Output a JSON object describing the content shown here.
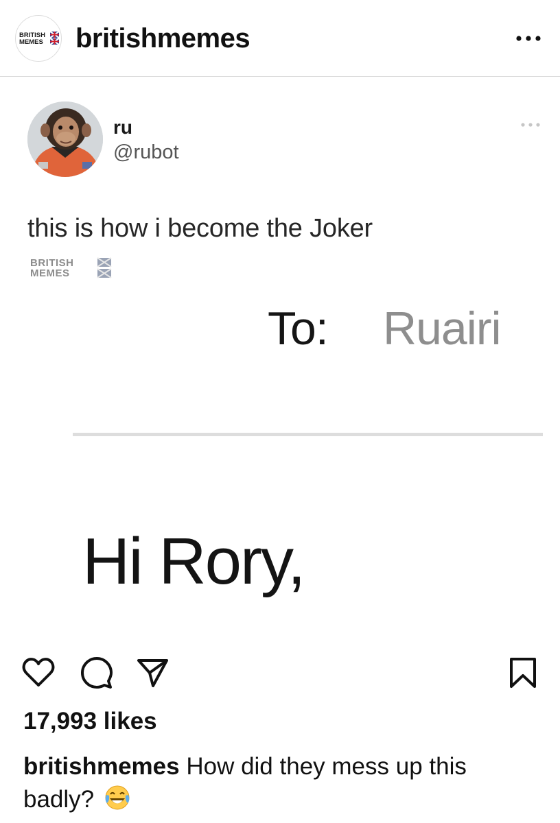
{
  "header": {
    "avatar_logo": "BRITISH MEMES",
    "username": "britishmemes",
    "more_icon": "more-horizontal-icon"
  },
  "tweet": {
    "display_name": "ru",
    "handle": "@rubot",
    "text": "this is how i become the Joker",
    "watermark": "BRITISH MEMES",
    "more_icon": "more-horizontal-icon"
  },
  "email_image": {
    "to_label": "To:",
    "to_value": "Ruairi",
    "greeting": "Hi Rory,"
  },
  "actions": {
    "icons": [
      "heart-icon",
      "comment-icon",
      "share-icon",
      "bookmark-icon"
    ]
  },
  "post": {
    "likes": "17,993 likes",
    "caption_user": "britishmemes",
    "caption_text": "How did they mess up this badly?",
    "caption_emoji": "face-with-tears-of-joy-emoji"
  },
  "colors": {
    "divider": "#dbdbdb",
    "flag_blue": "#1f3a8f",
    "flag_red": "#d0202e"
  }
}
